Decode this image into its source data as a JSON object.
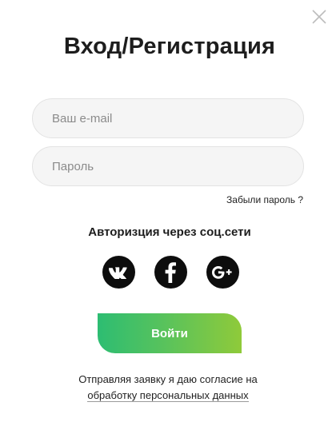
{
  "modal": {
    "title": "Вход/Регистрация",
    "close_icon": "close-icon"
  },
  "form": {
    "email_placeholder": "Ваш e-mail",
    "password_placeholder": "Пароль",
    "forgot_label": "Забыли пароль ?"
  },
  "social": {
    "title": "Авторизция через соц.сети",
    "items": [
      {
        "icon": "vk-icon",
        "color": "#0d0d0d"
      },
      {
        "icon": "facebook-icon",
        "color": "#0d0d0d"
      },
      {
        "icon": "google-plus-icon",
        "color": "#0d0d0d"
      }
    ]
  },
  "submit": {
    "label": "Войти",
    "gradient_start": "#2dbd72",
    "gradient_end": "#8fca3a"
  },
  "consent": {
    "text": "Отправляя заявку я даю согласие на",
    "link": "обработку персональных данных"
  }
}
